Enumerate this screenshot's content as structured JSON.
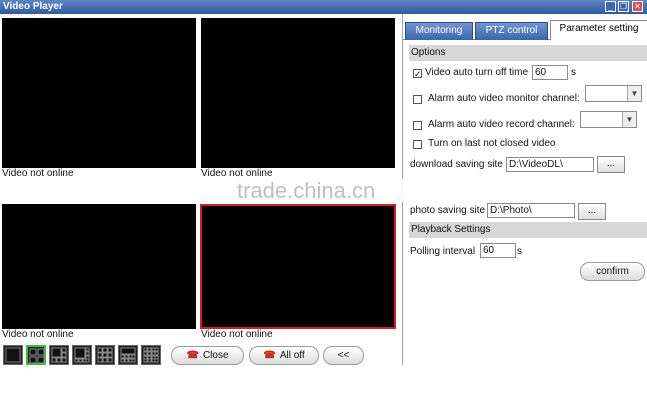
{
  "window": {
    "title": "Video Player",
    "controls": [
      "minimize",
      "restore",
      "close"
    ]
  },
  "video": {
    "panes": [
      {
        "status": "Video not online",
        "selected": false
      },
      {
        "status": "Video not online",
        "selected": false
      },
      {
        "status": "Video not online",
        "selected": false
      },
      {
        "status": "Video not online",
        "selected": true
      }
    ],
    "layout_buttons": [
      "layout-1",
      "layout-4",
      "layout-6",
      "layout-8",
      "layout-9",
      "layout-13",
      "layout-16"
    ],
    "active_layout": "layout-4"
  },
  "toolbar": {
    "close_label": "Close",
    "all_off_label": "All off",
    "collapse_label": "<<"
  },
  "tabs": [
    {
      "label": "Monitoring",
      "active": false
    },
    {
      "label": "PTZ control",
      "active": false
    },
    {
      "label": "Parameter setting",
      "active": true
    }
  ],
  "options": {
    "header": "Options",
    "auto_turn_off": {
      "label": "Video auto turn off time",
      "checked": true,
      "value": "60",
      "unit": "s"
    },
    "alarm_monitor": {
      "label": "Alarm auto video monitor channel:",
      "checked": false,
      "value": ""
    },
    "alarm_record": {
      "label": "Alarm auto video record channel:",
      "checked": false,
      "value": ""
    },
    "turn_on_last": {
      "label": "Turn on last not closed video",
      "checked": false
    },
    "download_site": {
      "label": "download saving site",
      "value": "D:\\VideoDL\\",
      "browse": "..."
    },
    "photo_site": {
      "label": "photo saving site",
      "value": "D:\\Photo\\",
      "browse": "..."
    }
  },
  "playback": {
    "header": "Playback Settings",
    "polling": {
      "label": "Polling interval",
      "value": "60",
      "unit": "s"
    },
    "confirm_label": "confirm"
  },
  "watermark": "trade.china.cn",
  "colors": {
    "titlebar": "#2f5a9e",
    "tab": "#3c66ab",
    "selected_pane": "#d21f1f",
    "active_layout": "#3cbf3c"
  }
}
